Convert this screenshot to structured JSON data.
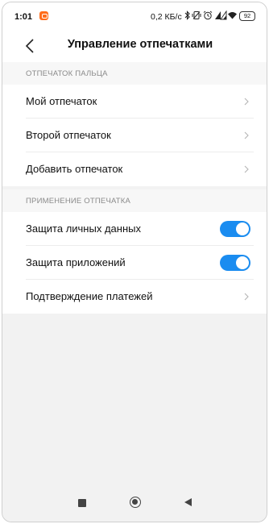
{
  "status_bar": {
    "time": "1:01",
    "speed": "0,2 КБ/с",
    "battery": "92",
    "icons": [
      "app-notification-icon",
      "bluetooth-icon",
      "vibrate-icon",
      "alarm-icon",
      "signal-icon",
      "signal-icon",
      "wifi-icon",
      "battery-icon"
    ]
  },
  "header": {
    "back_icon": "arrow-left-icon",
    "title": "Управление отпечатками"
  },
  "sections": [
    {
      "title": "ОТПЕЧАТОК ПАЛЬЦА",
      "items": [
        {
          "label": "Мой отпечаток",
          "control": "chevron"
        },
        {
          "label": "Второй отпечаток",
          "control": "chevron"
        },
        {
          "label": "Добавить отпечаток",
          "control": "chevron"
        }
      ]
    },
    {
      "title": "ПРИМЕНЕНИЕ ОТПЕЧАТКА",
      "items": [
        {
          "label": "Защита личных данных",
          "control": "toggle",
          "enabled": true
        },
        {
          "label": "Защита приложений",
          "control": "toggle",
          "enabled": true
        },
        {
          "label": "Подтверждение платежей",
          "control": "chevron"
        }
      ]
    }
  ],
  "colors": {
    "toggle_on": "#1a8cf0",
    "background": "#f2f2f2",
    "section_text": "#8a8a8a",
    "notification_app": "#ff6c1a"
  },
  "nav_bar": {
    "icons": [
      "recent-apps-icon",
      "home-icon",
      "back-icon"
    ]
  }
}
